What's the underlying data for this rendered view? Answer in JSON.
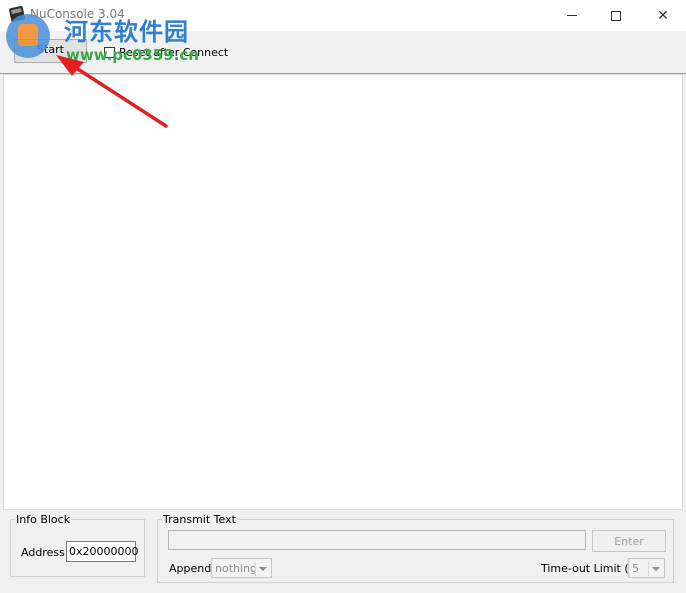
{
  "window": {
    "title": "NuConsole 3.04",
    "controls": {
      "minimize": "minimize-icon",
      "maximize": "maximize-icon",
      "close": "close-icon"
    }
  },
  "toolbar": {
    "start_label": "Start",
    "reset_after_connect_label": "Reset after Connect",
    "reset_after_connect_checked": false
  },
  "info_block": {
    "legend": "Info Block",
    "address_label": "Address",
    "address_value": "0x20000000"
  },
  "transmit": {
    "legend": "Transmit Text",
    "text_value": "",
    "enter_label": "Enter",
    "append_label": "Append",
    "append_value": "nothing",
    "timeout_label": "Time-out Limit (s)",
    "timeout_value": "5"
  },
  "watermark": {
    "site_name": "河东软件园",
    "url": "www.pc0359.cn"
  },
  "colors": {
    "annotation_arrow": "#e02020",
    "watermark_blue": "#2e7fd0",
    "watermark_green": "#38a84a"
  }
}
